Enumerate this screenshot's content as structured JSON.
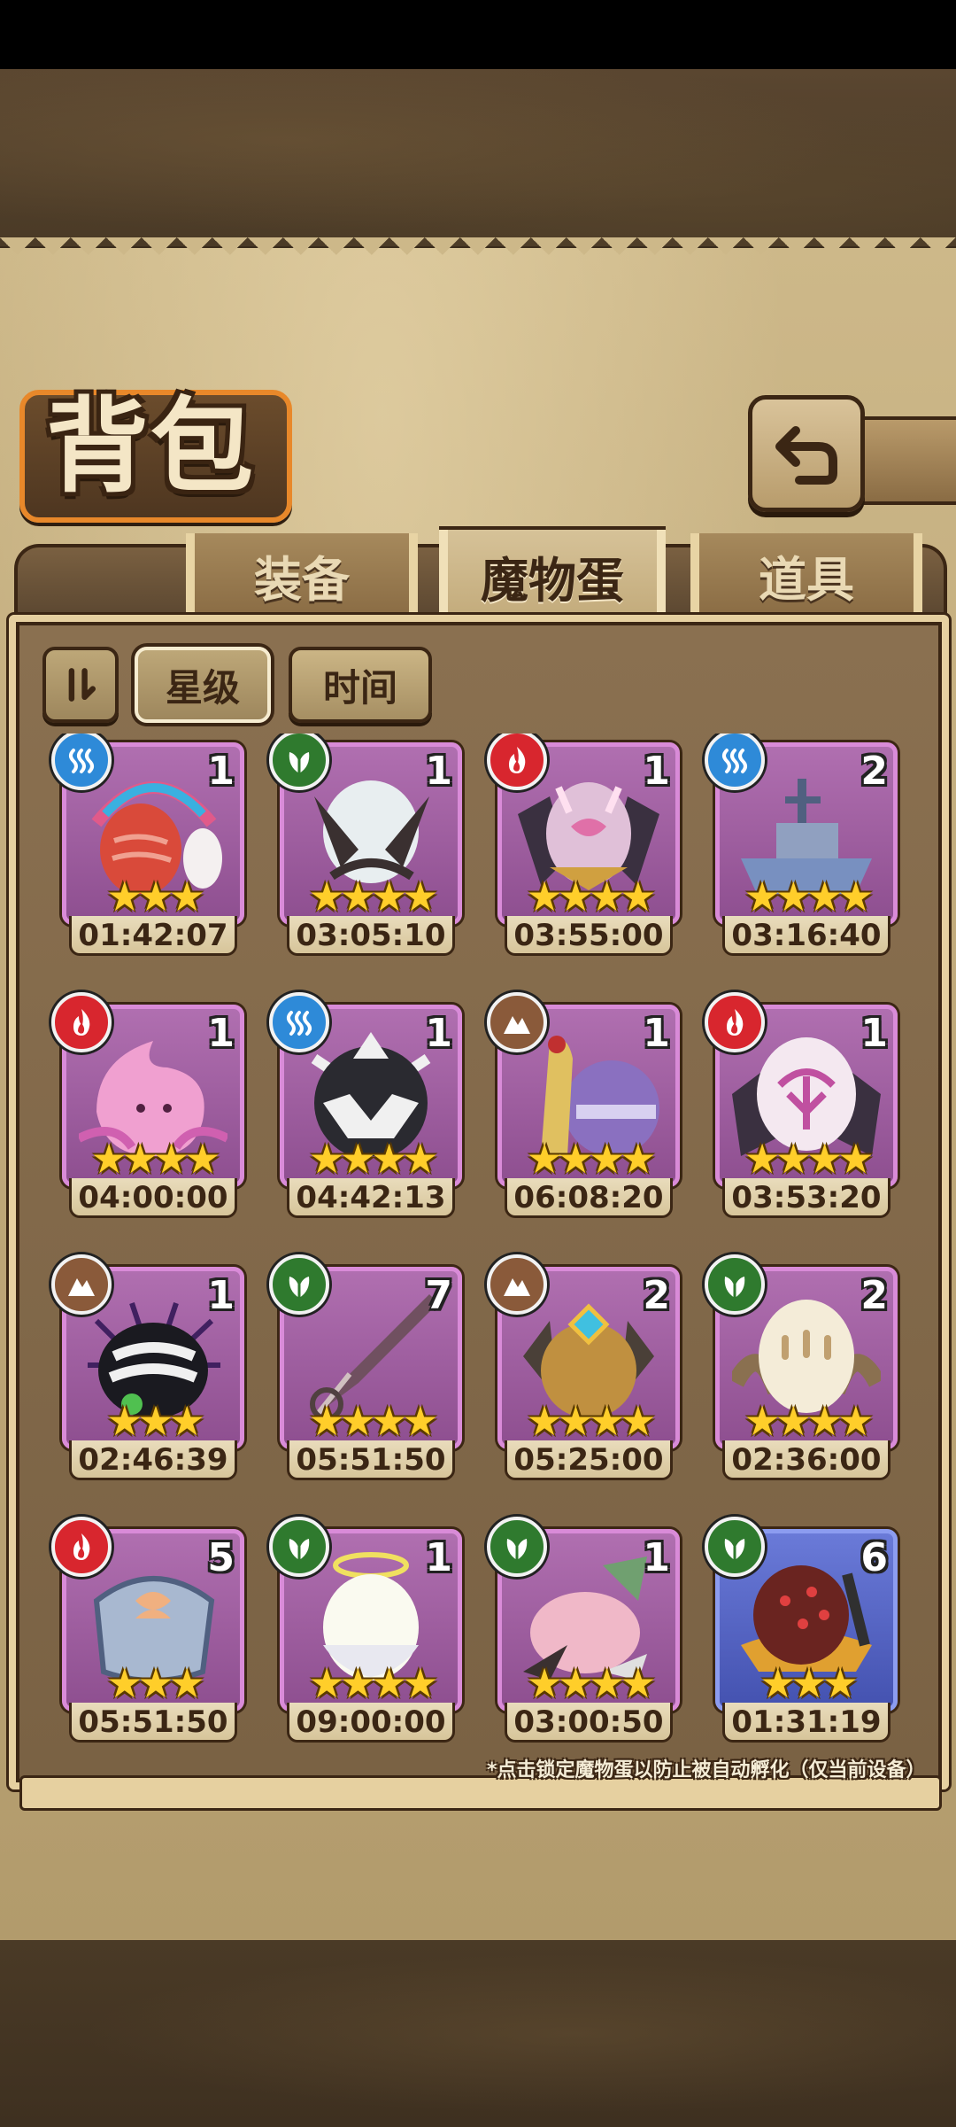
{
  "header": {
    "title": "背包"
  },
  "tabs": [
    {
      "label": "装备",
      "active": false
    },
    {
      "label": "魔物蛋",
      "active": true
    },
    {
      "label": "道具",
      "active": false
    }
  ],
  "sort": {
    "star_label": "星级",
    "time_label": "时间"
  },
  "eggs": [
    {
      "element": "water",
      "count": "1",
      "stars": "★★★",
      "timer": "01:42:07",
      "art": "red-striped-feather-egg"
    },
    {
      "element": "nature",
      "count": "1",
      "stars": "★★★★",
      "timer": "03:05:10",
      "art": "horned-pearl-egg"
    },
    {
      "element": "fire",
      "count": "1",
      "stars": "★★★★",
      "timer": "03:55:00",
      "art": "bat-wing-demon-egg"
    },
    {
      "element": "water",
      "count": "2",
      "stars": "★★★★",
      "timer": "03:16:40",
      "art": "battleship-egg"
    },
    {
      "element": "fire",
      "count": "1",
      "stars": "★★★★",
      "timer": "04:00:00",
      "art": "pink-flame-slime-egg"
    },
    {
      "element": "water",
      "count": "1",
      "stars": "★★★★",
      "timer": "04:42:13",
      "art": "black-spiked-helmet-egg"
    },
    {
      "element": "earth",
      "count": "1",
      "stars": "★★★★",
      "timer": "06:08:20",
      "art": "cobra-purple-egg"
    },
    {
      "element": "fire",
      "count": "1",
      "stars": "★★★★",
      "timer": "03:53:20",
      "art": "white-rune-winged-egg"
    },
    {
      "element": "earth",
      "count": "1",
      "stars": "★★★",
      "timer": "02:46:39",
      "art": "spider-striped-egg"
    },
    {
      "element": "nature",
      "count": "7",
      "stars": "★★★★",
      "timer": "05:51:50",
      "art": "kunai-egg"
    },
    {
      "element": "earth",
      "count": "2",
      "stars": "★★★★",
      "timer": "05:25:00",
      "art": "golden-gem-beast-egg"
    },
    {
      "element": "nature",
      "count": "2",
      "stars": "★★★★",
      "timer": "02:36:00",
      "art": "feathered-cream-egg"
    },
    {
      "element": "fire",
      "count": "5",
      "stars": "★★★",
      "timer": "05:51:50",
      "art": "steel-bandage-egg"
    },
    {
      "element": "nature",
      "count": "1",
      "stars": "★★★★",
      "timer": "09:00:00",
      "art": "angel-halo-egg"
    },
    {
      "element": "nature",
      "count": "1",
      "stars": "★★★★",
      "timer": "03:00:50",
      "art": "pink-leaf-pig-egg"
    },
    {
      "element": "nature",
      "count": "6",
      "stars": "★★★",
      "timer": "01:31:19",
      "art": "spotted-feather-hat-egg",
      "rarity": "blue"
    }
  ],
  "hint": "*点击锁定魔物蛋以防止被自动孵化（仅当前设备）",
  "colors": {
    "card_purple": "#b06fb0",
    "card_blue": "#6a7ad8",
    "star": "#ffce2a",
    "accent_orange": "#e8882a"
  }
}
